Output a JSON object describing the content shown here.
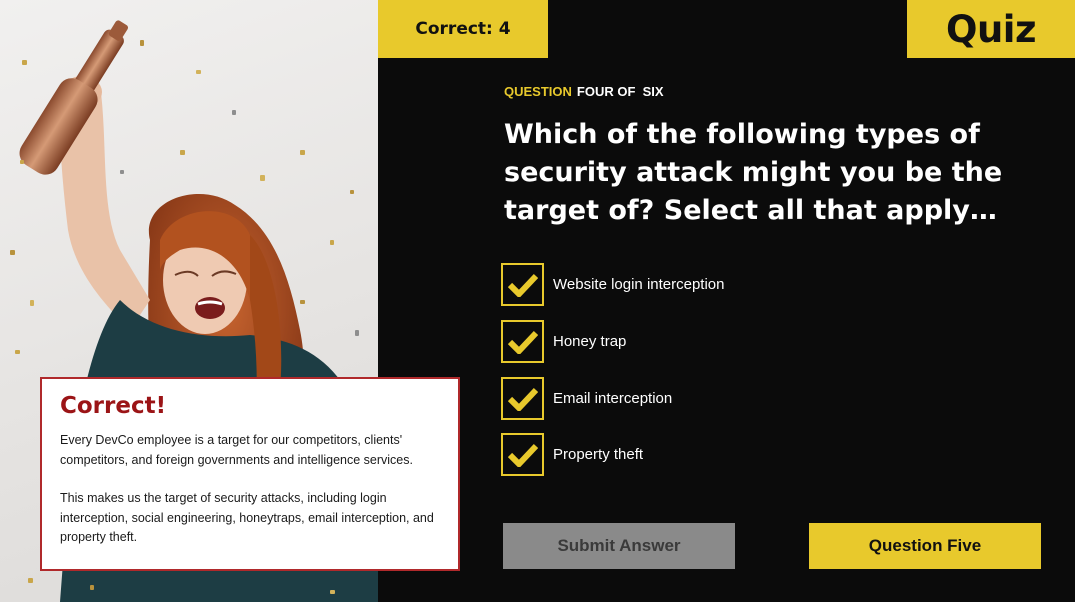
{
  "header": {
    "score": "Correct: 4",
    "quiz_label": "Quiz"
  },
  "question": {
    "lead": "QUESTION",
    "number_text": "FOUR OF  SIX",
    "text": "Which of the following types of security attack might you be the target of? Select all that apply…"
  },
  "options": [
    {
      "label": "Website login interception",
      "checked": true
    },
    {
      "label": "Honey trap",
      "checked": true
    },
    {
      "label": "Email interception",
      "checked": true
    },
    {
      "label": "Property theft",
      "checked": true
    }
  ],
  "buttons": {
    "submit": "Submit Answer",
    "next": "Question Five"
  },
  "feedback": {
    "title": "Correct!",
    "paragraph_1": "Every DevCo employee is a target for our competitors, clients' competitors, and foreign governments and intelligence services.",
    "paragraph_2": "This makes us the target of security attacks, including login interception, social engineering, honeytraps, email interception, and property theft."
  },
  "colors": {
    "accent": "#e8c92c",
    "background": "#0b0b0b",
    "feedback_title": "#9b1416",
    "feedback_border": "#b0292b",
    "button_disabled": "#8a8a8a"
  },
  "icons": {
    "checkbox": "checkmark-icon"
  }
}
